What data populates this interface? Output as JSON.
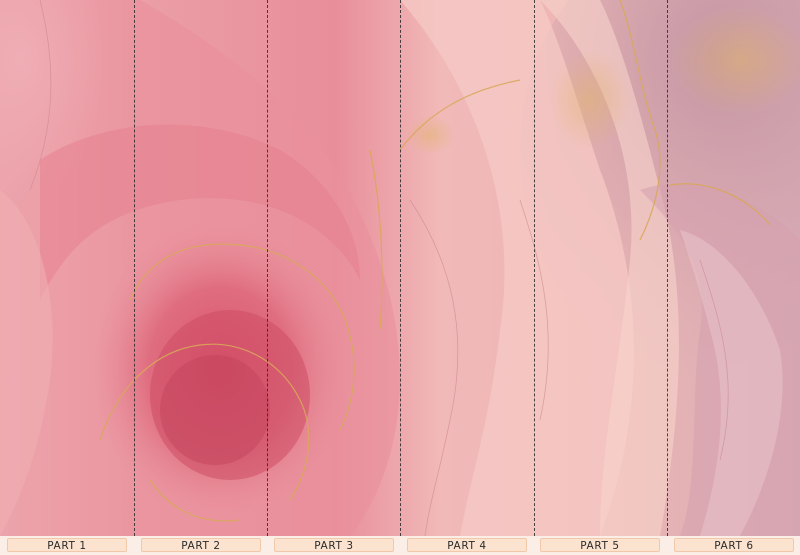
{
  "mural": {
    "parts": [
      {
        "label": "PART 1"
      },
      {
        "label": "PART 2"
      },
      {
        "label": "PART 3"
      },
      {
        "label": "PART 4"
      },
      {
        "label": "PART 5"
      },
      {
        "label": "PART 6"
      }
    ],
    "colors": {
      "base_pink": "#e98b98",
      "deep_rose": "#c8445d",
      "blush": "#f4c3c3",
      "mauve": "#b6869a",
      "gold": "#d9a85a",
      "divider": "#2a2a2a",
      "label_bg": "#fbe3cf"
    }
  }
}
